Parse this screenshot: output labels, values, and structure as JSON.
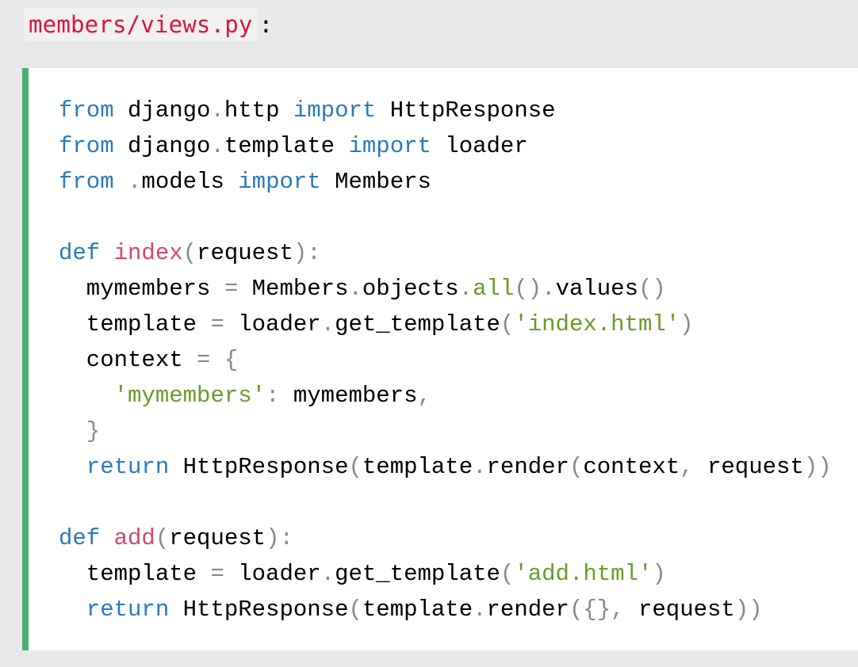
{
  "filename": "members/views.py",
  "filename_suffix": ":",
  "code_lines": [
    [
      {
        "t": "kw",
        "v": "from"
      },
      {
        "t": "n",
        "v": " django"
      },
      {
        "t": "p",
        "v": "."
      },
      {
        "t": "n",
        "v": "http "
      },
      {
        "t": "kw",
        "v": "import"
      },
      {
        "t": "n",
        "v": " HttpResponse"
      }
    ],
    [
      {
        "t": "kw",
        "v": "from"
      },
      {
        "t": "n",
        "v": " django"
      },
      {
        "t": "p",
        "v": "."
      },
      {
        "t": "n",
        "v": "template "
      },
      {
        "t": "kw",
        "v": "import"
      },
      {
        "t": "n",
        "v": " loader"
      }
    ],
    [
      {
        "t": "kw",
        "v": "from"
      },
      {
        "t": "n",
        "v": " "
      },
      {
        "t": "p",
        "v": "."
      },
      {
        "t": "n",
        "v": "models "
      },
      {
        "t": "kw",
        "v": "import"
      },
      {
        "t": "n",
        "v": " Members"
      }
    ],
    [],
    [
      {
        "t": "kw",
        "v": "def"
      },
      {
        "t": "n",
        "v": " "
      },
      {
        "t": "fn",
        "v": "index"
      },
      {
        "t": "p",
        "v": "("
      },
      {
        "t": "n",
        "v": "request"
      },
      {
        "t": "p",
        "v": "):"
      }
    ],
    [
      {
        "t": "n",
        "v": "  mymembers "
      },
      {
        "t": "p",
        "v": "="
      },
      {
        "t": "n",
        "v": " Members"
      },
      {
        "t": "p",
        "v": "."
      },
      {
        "t": "n",
        "v": "objects"
      },
      {
        "t": "p",
        "v": "."
      },
      {
        "t": "str",
        "v": "all"
      },
      {
        "t": "p",
        "v": "()."
      },
      {
        "t": "n",
        "v": "values"
      },
      {
        "t": "p",
        "v": "()"
      }
    ],
    [
      {
        "t": "n",
        "v": "  template "
      },
      {
        "t": "p",
        "v": "="
      },
      {
        "t": "n",
        "v": " loader"
      },
      {
        "t": "p",
        "v": "."
      },
      {
        "t": "n",
        "v": "get_template"
      },
      {
        "t": "p",
        "v": "("
      },
      {
        "t": "str",
        "v": "'index.html'"
      },
      {
        "t": "p",
        "v": ")"
      }
    ],
    [
      {
        "t": "n",
        "v": "  context "
      },
      {
        "t": "p",
        "v": "= {"
      }
    ],
    [
      {
        "t": "n",
        "v": "    "
      },
      {
        "t": "str",
        "v": "'mymembers'"
      },
      {
        "t": "p",
        "v": ":"
      },
      {
        "t": "n",
        "v": " mymembers"
      },
      {
        "t": "p",
        "v": ","
      }
    ],
    [
      {
        "t": "n",
        "v": "  "
      },
      {
        "t": "p",
        "v": "}"
      }
    ],
    [
      {
        "t": "n",
        "v": "  "
      },
      {
        "t": "kw",
        "v": "return"
      },
      {
        "t": "n",
        "v": " HttpResponse"
      },
      {
        "t": "p",
        "v": "("
      },
      {
        "t": "n",
        "v": "template"
      },
      {
        "t": "p",
        "v": "."
      },
      {
        "t": "n",
        "v": "render"
      },
      {
        "t": "p",
        "v": "("
      },
      {
        "t": "n",
        "v": "context"
      },
      {
        "t": "p",
        "v": ","
      },
      {
        "t": "n",
        "v": " request"
      },
      {
        "t": "p",
        "v": "))"
      }
    ],
    [],
    [
      {
        "t": "kw",
        "v": "def"
      },
      {
        "t": "n",
        "v": " "
      },
      {
        "t": "fn",
        "v": "add"
      },
      {
        "t": "p",
        "v": "("
      },
      {
        "t": "n",
        "v": "request"
      },
      {
        "t": "p",
        "v": "):"
      }
    ],
    [
      {
        "t": "n",
        "v": "  template "
      },
      {
        "t": "p",
        "v": "="
      },
      {
        "t": "n",
        "v": " loader"
      },
      {
        "t": "p",
        "v": "."
      },
      {
        "t": "n",
        "v": "get_template"
      },
      {
        "t": "p",
        "v": "("
      },
      {
        "t": "str",
        "v": "'add.html'"
      },
      {
        "t": "p",
        "v": ")"
      }
    ],
    [
      {
        "t": "n",
        "v": "  "
      },
      {
        "t": "kw",
        "v": "return"
      },
      {
        "t": "n",
        "v": " HttpResponse"
      },
      {
        "t": "p",
        "v": "("
      },
      {
        "t": "n",
        "v": "template"
      },
      {
        "t": "p",
        "v": "."
      },
      {
        "t": "n",
        "v": "render"
      },
      {
        "t": "p",
        "v": "({},"
      },
      {
        "t": "n",
        "v": " request"
      },
      {
        "t": "p",
        "v": "))"
      }
    ]
  ]
}
